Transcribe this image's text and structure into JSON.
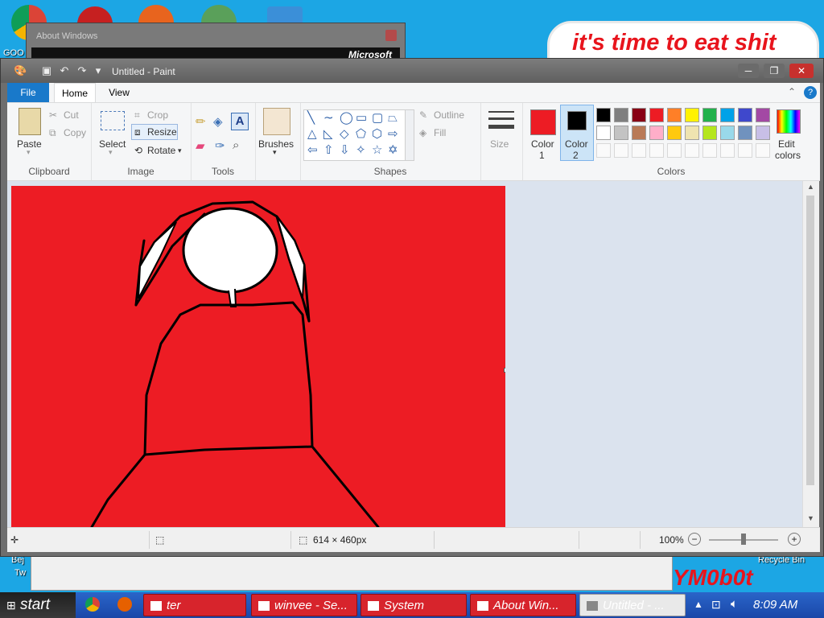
{
  "desktop": {
    "left_label_1": "GOO",
    "left_label_2": "Bej",
    "left_label_3": "Tw",
    "banner_text": "it's time to eat shit",
    "recycle_bin": "Recycle Bin",
    "bottom_logo": "YM0b0t"
  },
  "about_window": {
    "title": "About Windows",
    "brand": "Microsoft"
  },
  "paint": {
    "title": "Untitled - Paint",
    "tabs": [
      "File",
      "Home",
      "View"
    ],
    "clipboard": {
      "paste": "Paste",
      "cut": "Cut",
      "copy": "Copy",
      "group": "Clipboard"
    },
    "image": {
      "select": "Select",
      "crop": "Crop",
      "resize": "Resize",
      "rotate": "Rotate",
      "group": "Image"
    },
    "tools": {
      "group": "Tools"
    },
    "brushes": "Brushes",
    "shapes": {
      "outline": "Outline",
      "fill": "Fill",
      "group": "Shapes"
    },
    "size": "Size",
    "color1": {
      "label1": "Color",
      "label2": "1",
      "value": "#ed1c24"
    },
    "color2": {
      "label1": "Color",
      "label2": "2",
      "value": "#000000"
    },
    "edit_colors": {
      "line1": "Edit",
      "line2": "colors"
    },
    "colors_group": "Colors",
    "palette_row1": [
      "#000000",
      "#7f7f7f",
      "#880015",
      "#ed1c24",
      "#ff7f27",
      "#fff200",
      "#22b14c",
      "#00a2e8",
      "#3f48cc",
      "#a349a4"
    ],
    "palette_row2": [
      "#ffffff",
      "#c3c3c3",
      "#b97a57",
      "#ffaec9",
      "#ffc90e",
      "#efe4b0",
      "#b5e61d",
      "#99d9ea",
      "#7092be",
      "#c8bfe7"
    ],
    "status": {
      "size": "614 × 460px",
      "zoom": "100%"
    }
  },
  "taskbar": {
    "start": "start",
    "items": [
      "ter",
      "winvee - Se...",
      "System",
      "About Win...",
      "Untitled - ..."
    ],
    "clock": "8:09 AM"
  }
}
